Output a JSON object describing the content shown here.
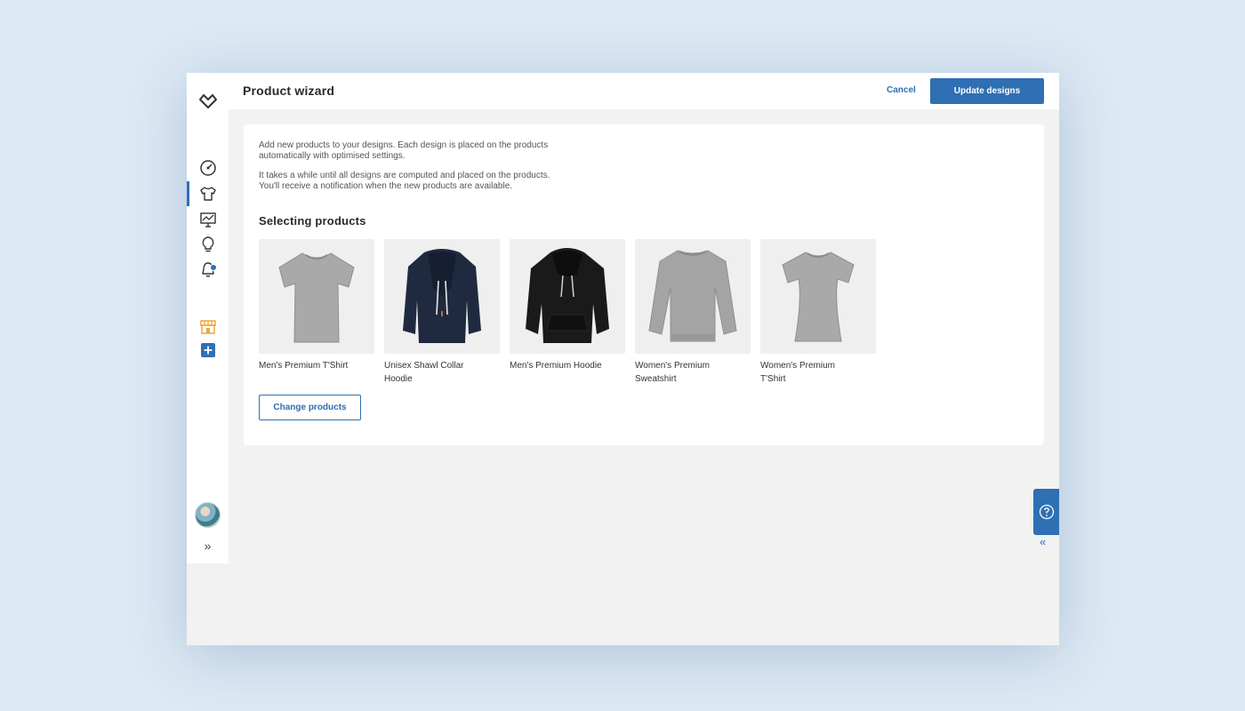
{
  "header": {
    "title": "Product wizard",
    "cancel_label": "Cancel",
    "update_label": "Update designs"
  },
  "intro": {
    "p1_line1": "Add new products to your designs. Each design is placed on the products",
    "p1_line2": "automatically with optimised settings.",
    "p2_line1": "It takes a while until all designs are computed and placed on the products.",
    "p2_line2": "You'll receive a notification when the new products are available."
  },
  "section": {
    "title": "Selecting products"
  },
  "products": [
    {
      "label": "Men's Premium T'Shirt",
      "color": "#a7a7a7",
      "kind": "tshirt"
    },
    {
      "label": "Unisex Shawl Collar Hoodie",
      "color": "#1f2a40",
      "kind": "hoodie"
    },
    {
      "label": "Men's Premium Hoodie",
      "color": "#1a1a1a",
      "kind": "hoodie"
    },
    {
      "label": "Women's Premium Sweatshirt",
      "color": "#a4a4a4",
      "kind": "sweatshirt"
    },
    {
      "label": "Women's Premium T'Shirt",
      "color": "#a7a7a7",
      "kind": "tshirt"
    }
  ],
  "actions": {
    "change_products_label": "Change products"
  },
  "sidebar": {
    "items": [
      {
        "icon": "dashboard-gauge-icon"
      },
      {
        "icon": "tshirt-icon",
        "active": true
      },
      {
        "icon": "presentation-chart-icon"
      },
      {
        "icon": "lightbulb-icon"
      },
      {
        "icon": "bell-icon"
      },
      {
        "icon": "shop-icon"
      },
      {
        "icon": "add-square-icon"
      }
    ],
    "expand_glyph": "»"
  },
  "help": {
    "collapse_glyph": "«"
  },
  "colors": {
    "accent": "#2f6fb3",
    "shop_icon": "#f0a63a",
    "background": "#f2f2f2"
  }
}
